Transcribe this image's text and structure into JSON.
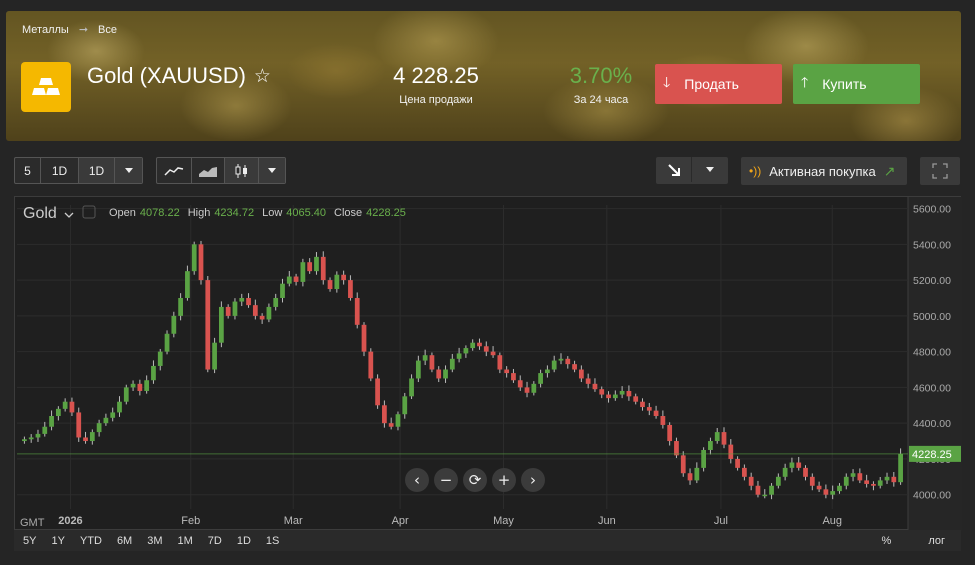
{
  "breadcrumbs": [
    "Металлы",
    "Все"
  ],
  "instrument": {
    "name": "Gold (XAUUSD)",
    "favorite_icon": "star-outline-icon"
  },
  "quote": {
    "price": "4 228.25",
    "price_label": "Цена продажи",
    "change": "3.70%",
    "change_label": "За 24 часа"
  },
  "actions": {
    "sell": "Продать",
    "buy": "Купить"
  },
  "toolbar": {
    "intervals": [
      "5",
      "1D",
      "1D"
    ],
    "chart_types": [
      "line-chart-icon",
      "area-chart-icon",
      "candlestick-icon"
    ],
    "active_buy": "Активная покупка"
  },
  "legend": {
    "symbol": "Gold",
    "open_label": "Open",
    "open": "4078.22",
    "high_label": "High",
    "high": "4234.72",
    "low_label": "Low",
    "low": "4065.40",
    "close_label": "Close",
    "close": "4228.25"
  },
  "ranges": [
    "5Y",
    "1Y",
    "YTD",
    "6M",
    "3M",
    "1M",
    "7D",
    "1D",
    "1S"
  ],
  "scale_options": [
    "%",
    "лог"
  ],
  "colors": {
    "up": "#5aa344",
    "down": "#d9534f",
    "accent": "#f5b800"
  },
  "chart_data": {
    "type": "candlestick",
    "timezone_label": "GMT",
    "x_ticks": [
      "2026",
      "Feb",
      "Mar",
      "Apr",
      "May",
      "Jun",
      "Jul",
      "Aug"
    ],
    "y_ticks": [
      "5600.00",
      "5400.00",
      "5200.00",
      "5000.00",
      "4800.00",
      "4600.00",
      "4400.00",
      "4200.00",
      "4000.00"
    ],
    "ylim": [
      3920,
      5620
    ],
    "current_price": "4228.25",
    "closes": [
      4310,
      4320,
      4340,
      4380,
      4440,
      4480,
      4520,
      4460,
      4320,
      4300,
      4350,
      4400,
      4430,
      4460,
      4520,
      4600,
      4620,
      4580,
      4640,
      4720,
      4800,
      4900,
      5000,
      5100,
      5250,
      5400,
      5200,
      4700,
      4850,
      5050,
      5000,
      5080,
      5100,
      5060,
      5000,
      4980,
      5050,
      5100,
      5180,
      5220,
      5190,
      5300,
      5250,
      5330,
      5200,
      5150,
      5230,
      5200,
      5100,
      4950,
      4800,
      4650,
      4500,
      4400,
      4380,
      4450,
      4550,
      4650,
      4750,
      4780,
      4700,
      4650,
      4700,
      4760,
      4790,
      4820,
      4850,
      4830,
      4800,
      4780,
      4700,
      4680,
      4640,
      4600,
      4570,
      4620,
      4680,
      4700,
      4750,
      4760,
      4730,
      4700,
      4650,
      4620,
      4590,
      4560,
      4540,
      4560,
      4580,
      4550,
      4520,
      4490,
      4470,
      4440,
      4390,
      4300,
      4220,
      4120,
      4080,
      4150,
      4250,
      4300,
      4350,
      4280,
      4200,
      4150,
      4100,
      4050,
      4000,
      4000,
      4050,
      4100,
      4150,
      4180,
      4150,
      4100,
      4050,
      4030,
      4000,
      4020,
      4050,
      4100,
      4120,
      4080,
      4060,
      4050,
      4080,
      4100,
      4070,
      4228
    ]
  }
}
